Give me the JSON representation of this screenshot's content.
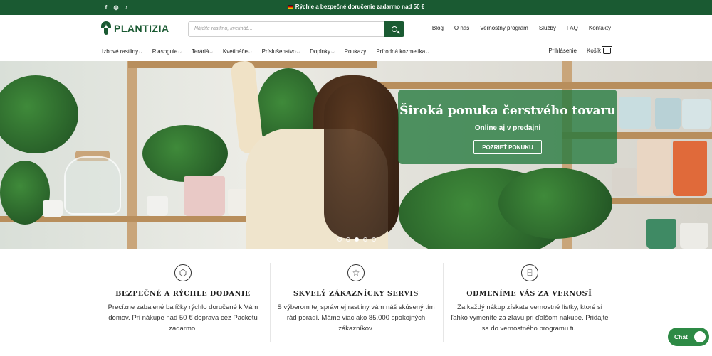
{
  "topbar": {
    "socials": [
      "facebook-icon",
      "instagram-icon",
      "tiktok-icon"
    ],
    "promo_text": "Rýchle a bezpečné doručenie zadarmo nad 50 €"
  },
  "header": {
    "logo_text": "PLANTIZIA",
    "search_placeholder": "Nájdite rastlinu, kvetináč...",
    "top_links": [
      "Blog",
      "O nás",
      "Vernostný program",
      "Služby",
      "FAQ",
      "Kontakty"
    ]
  },
  "catnav": {
    "items": [
      {
        "label": "Izbové rastliny",
        "dropdown": true
      },
      {
        "label": "Riasogule",
        "dropdown": true
      },
      {
        "label": "Teráriá",
        "dropdown": true
      },
      {
        "label": "Kvetináče",
        "dropdown": true
      },
      {
        "label": "Príslušenstvo",
        "dropdown": true
      },
      {
        "label": "Doplnky",
        "dropdown": true
      },
      {
        "label": "Poukazy",
        "dropdown": false
      },
      {
        "label": "Prírodná kozmetika",
        "dropdown": true
      }
    ],
    "login": "Prihlásenie",
    "cart": "Košík"
  },
  "hero": {
    "title": "Široká ponuka čerstvého tovaru",
    "subtitle": "Online aj v predajni",
    "cta": "POZRIEŤ PONUKU",
    "slide_count": 5,
    "active_slide": 3
  },
  "features": [
    {
      "icon": "box-icon",
      "title": "BEZPEČNÉ A RÝCHLE DODANIE",
      "text": "Precízne zabalené balíčky rýchlo doručené k Vám domov. Pri nákupe nad 50 € doprava cez Packetu zadarmo."
    },
    {
      "icon": "star-icon",
      "title": "SKVELÝ ZÁKAZNÍCKY SERVIS",
      "text": "S výberom tej správnej rastliny vám náš skúsený tím rád poradí. Máme viac ako  85,000 spokojných zákazníkov."
    },
    {
      "icon": "gift-icon",
      "title": "ODMENÍME VÁS ZA VERNOSŤ",
      "text": "Za každý nákup získate vernostné lístky, ktoré si ľahko vymeníte za zľavu pri ďalšom nákupe. Pridajte sa do vernostného programu tu."
    }
  ],
  "chat": {
    "label": "Chat"
  },
  "colors": {
    "brand_green": "#1a5a32",
    "chat_green": "#2d8a45"
  }
}
